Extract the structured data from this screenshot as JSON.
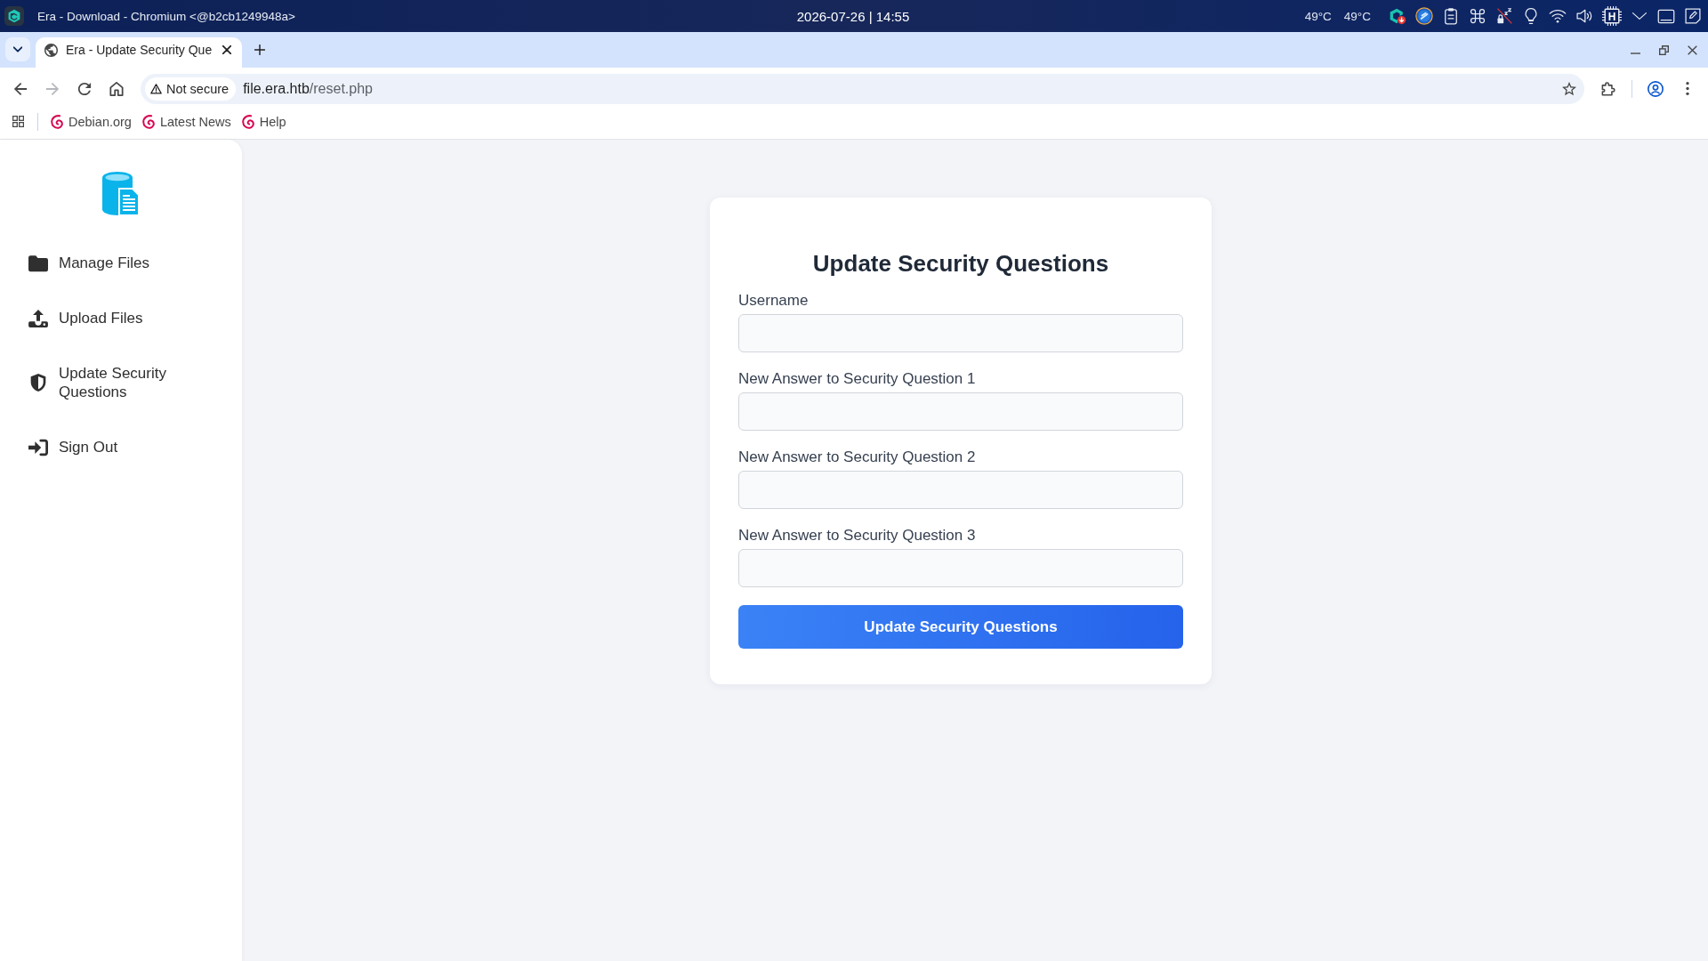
{
  "system_bar": {
    "window_title": "Era - Download - Chromium <@b2cb1249948a>",
    "clock": "2026-07-26 | 14:55",
    "temperatures": [
      "49°C",
      "49°C"
    ],
    "chip_label": "H"
  },
  "browser": {
    "tabs": [
      {
        "title": "Era - Update Security Que",
        "selected": true
      }
    ],
    "toolbar_buttons": [
      {
        "kind": "back",
        "disabled": false
      },
      {
        "kind": "forward",
        "disabled": true
      },
      {
        "kind": "reload",
        "disabled": false
      },
      {
        "kind": "home",
        "disabled": false
      }
    ],
    "address_bar": {
      "security_label": "Not secure",
      "host": "file.era.htb",
      "path": "/reset.php"
    },
    "bookmarks": [
      "Debian.org",
      "Latest News",
      "Help"
    ]
  },
  "sidebar": {
    "items": [
      {
        "kind": "folder",
        "label": "Manage Files",
        "selected": false
      },
      {
        "kind": "upload",
        "label": "Upload Files",
        "selected": false
      },
      {
        "kind": "shield",
        "label": "Update Security Questions",
        "selected": false
      },
      {
        "kind": "sign_in",
        "label": "Sign Out",
        "selected": false
      }
    ]
  },
  "form": {
    "title": "Update Security Questions",
    "fields": [
      {
        "label": "Username"
      },
      {
        "label": "New Answer to Security Question 1"
      },
      {
        "label": "New Answer to Security Question 2"
      },
      {
        "label": "New Answer to Security Question 3"
      }
    ],
    "submit_label": "Update Security Questions"
  }
}
